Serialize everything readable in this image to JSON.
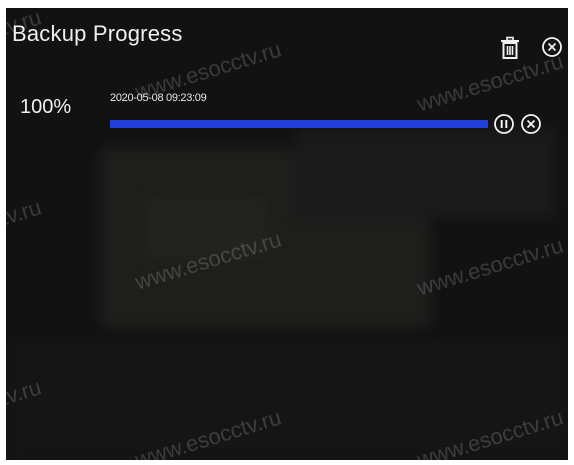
{
  "header": {
    "title": "Backup Progress",
    "delete_icon": "trash-icon",
    "close_icon": "circle-x-icon"
  },
  "task": {
    "percent_label": "100%",
    "timestamp": "2020-05-08 09:23:09",
    "progress_fraction": 1.0,
    "pause_icon": "pause-circle-icon",
    "cancel_icon": "circle-x-icon"
  },
  "watermarks": [
    "www.esocctv.ru",
    "www.esocctv.ru",
    "www.esocctv.ru",
    "www.esocctv.ru",
    "www.esocctv.ru",
    "www.esocctv.ru",
    "www.esocctv.ru",
    "www.esocctv.ru",
    "www.esocctv.ru"
  ],
  "colors": {
    "progress_fill": "#1f3fd8",
    "background": "#121212",
    "text": "#f0f0f0"
  }
}
